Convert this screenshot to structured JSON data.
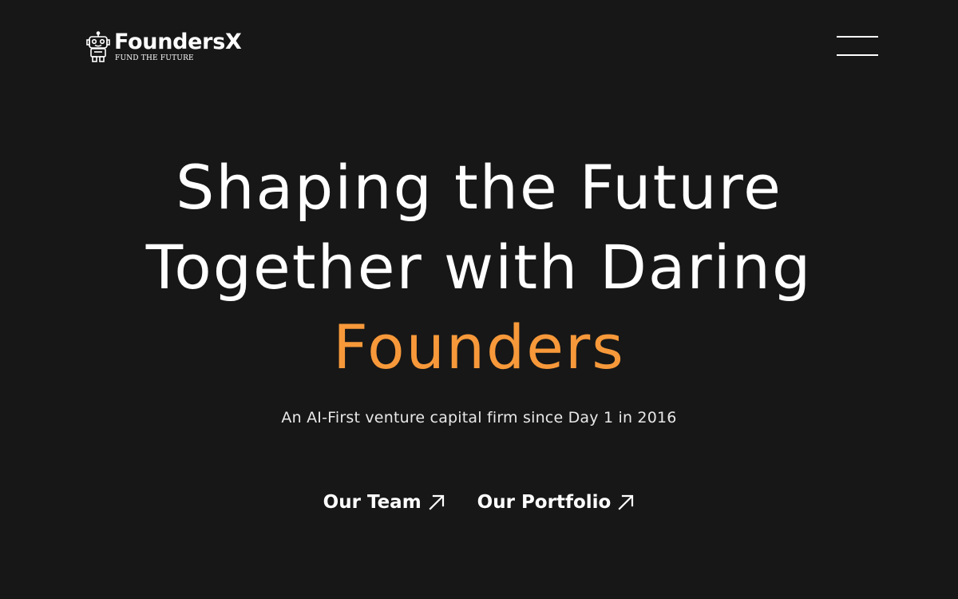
{
  "header": {
    "logo_name": "FoundersX",
    "logo_tagline": "FUND THE FUTURE",
    "logo_icon": "robot-icon",
    "menu_icon": "hamburger-icon"
  },
  "hero": {
    "headline_line1": "Shaping the Future",
    "headline_line2": "Together with Daring",
    "headline_accent": "Founders",
    "subtitle": "An AI-First venture capital firm since Day 1 in 2016"
  },
  "cta": {
    "team_label": "Our Team",
    "portfolio_label": "Our Portfolio",
    "arrow_icon": "arrow-up-right-icon"
  },
  "colors": {
    "background": "#171717",
    "text": "#ffffff",
    "accent": "#f7993a"
  }
}
